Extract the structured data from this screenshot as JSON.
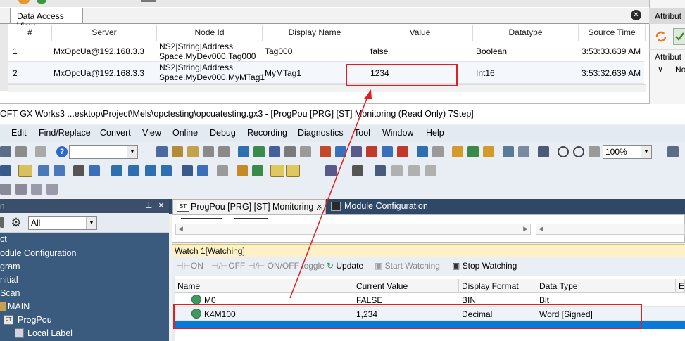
{
  "data_access_view": {
    "tab_label": "Data Access View",
    "columns": [
      "#",
      "Server",
      "Node Id",
      "Display Name",
      "Value",
      "Datatype",
      "Source Time"
    ],
    "rows": [
      {
        "num": "1",
        "server": "MxOpcUa@192.168.3.3",
        "node_id_line1": "NS2|String|Address",
        "node_id_line2": "Space.MyDev000.Tag000",
        "display_name": "Tag000",
        "value": "false",
        "datatype": "Boolean",
        "source_time": "3:53:33.639 AM"
      },
      {
        "num": "2",
        "server": "MxOpcUa@192.168.3.3",
        "node_id_line1": "NS2|String|Address",
        "node_id_line2": "Space.MyDev000.MyMTag1",
        "display_name": "MyMTag1",
        "value": "1234",
        "datatype": "Int16",
        "source_time": "3:53:32.639 AM"
      }
    ]
  },
  "attributes_panel": {
    "title": "Attribut",
    "sub_label": "Attribut",
    "tree_item": "No"
  },
  "window_title": "OFT GX Works3 ...esktop\\Project\\Mels\\opctesting\\opcuatesting.gx3 - [ProgPou [PRG] [ST] Monitoring (Read Only) 7Step]",
  "menu": [
    "Edit",
    "Find/Replace",
    "Convert",
    "View",
    "Online",
    "Debug",
    "Recording",
    "Diagnostics",
    "Tool",
    "Window",
    "Help"
  ],
  "toolbar": {
    "zoom": "100%"
  },
  "navigation": {
    "header": "n",
    "filter": "All",
    "tree": [
      "ct",
      "odule Configuration",
      "gram",
      "nitial",
      "Scan",
      "MAIN",
      "ProgPou",
      "Local Label"
    ]
  },
  "editor_tabs": {
    "prog_tab": "ProgPou [PRG] [ST] Monitoring ...",
    "prog_icon": "ST",
    "module_tab": "Module Configuration"
  },
  "watch": {
    "title": "Watch 1[Watching]",
    "toolbar": {
      "on": "ON",
      "off": "OFF",
      "toggle": "ON/OFF toggle",
      "update": "Update",
      "start": "Start Watching",
      "stop": "Stop Watching"
    },
    "columns": [
      "Name",
      "Current Value",
      "Display Format",
      "Data Type",
      "Er"
    ],
    "rows": [
      {
        "name": "M0",
        "value": "FALSE",
        "format": "BIN",
        "type": "Bit"
      },
      {
        "name": "K4M100",
        "value": "1,234",
        "format": "Decimal",
        "type": "Word [Signed]"
      }
    ]
  },
  "colors": {
    "highlight_red": "#e02020",
    "selection_blue": "#0a78d7",
    "nav_blue": "#3a5a7e"
  }
}
